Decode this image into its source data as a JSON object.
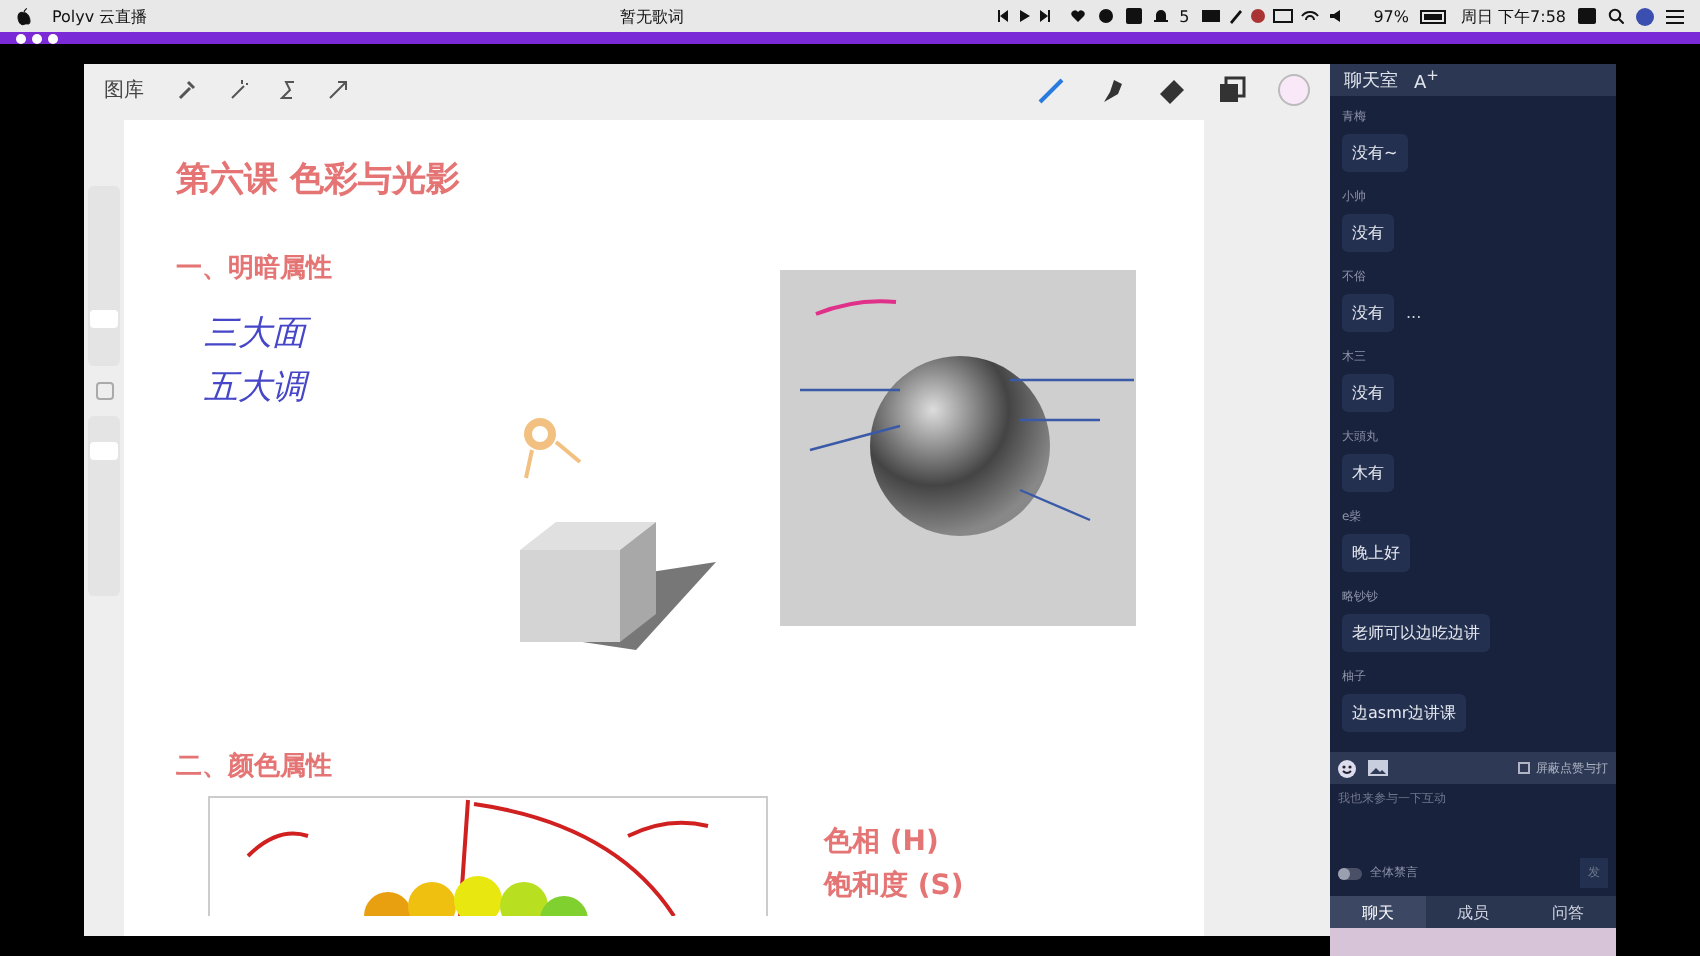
{
  "menubar": {
    "app": "Polyv 云直播",
    "lyrics": "暂无歌词",
    "badge_count": "5",
    "battery": "97%",
    "clock": "周日 下午7:58"
  },
  "toolbar": {
    "gallery": "图库"
  },
  "sidebar": {
    "brush_size": {
      "level": 0.23
    },
    "opacity": {
      "level": 0.84
    }
  },
  "canvas": {
    "title": "第六课 色彩与光影",
    "section_1": "一、明暗属性",
    "handwriting": [
      "三大面",
      "五大调"
    ],
    "section_2": "二、颜色属性",
    "color_notes": [
      "色相 (H)",
      "饱和度 (S)"
    ]
  },
  "chat": {
    "title": "聊天室",
    "font_button": "A$^{+}$",
    "messages": [
      {
        "user": "青梅",
        "text": "没有~"
      },
      {
        "user": "小帅",
        "text": "没有"
      },
      {
        "user": "不俗",
        "text": "没有",
        "trailing": "..."
      },
      {
        "user": "木三",
        "text": "没有"
      },
      {
        "user": "大頭丸",
        "text": "木有"
      },
      {
        "user": "e柴",
        "text": "晚上好"
      },
      {
        "user": "略钞钞",
        "text": "老师可以边吃边讲"
      },
      {
        "user": "柚子",
        "text": "边asmr边讲课"
      }
    ],
    "input_placeholder": "我也来参与一下互动",
    "block_option": {
      "label": "屏蔽点赞与打",
      "checked": false
    },
    "mute_all": {
      "label": "全体禁言",
      "on": false
    },
    "send": "发",
    "tabs": [
      {
        "label": "聊天",
        "selected": true
      },
      {
        "label": "成员",
        "selected": false
      },
      {
        "label": "问答",
        "selected": false
      }
    ]
  }
}
